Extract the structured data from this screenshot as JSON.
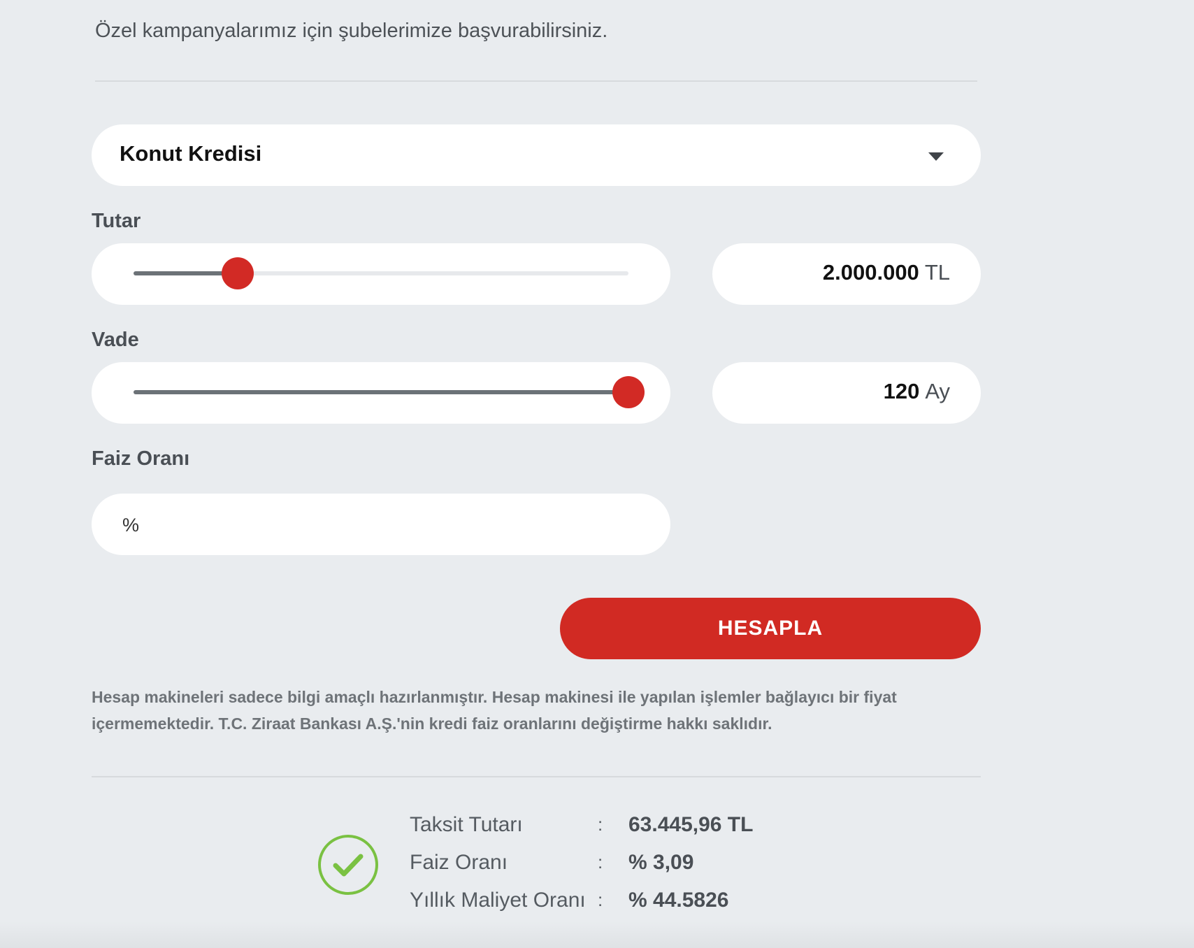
{
  "intro_text": "Özel kampanyalarımız için şubelerimize başvurabilirsiniz.",
  "loan_type": {
    "selected": "Konut Kredisi",
    "caret_icon": "chevron-down-icon"
  },
  "amount": {
    "label": "Tutar",
    "value": "2.000.000",
    "unit": "TL",
    "slider_fraction": 0.21
  },
  "term": {
    "label": "Vade",
    "value": "120",
    "unit": "Ay",
    "slider_fraction": 1.0
  },
  "interest": {
    "label": "Faiz Oranı",
    "prefix": "%"
  },
  "calculate_button": "HESAPLA",
  "disclaimer": "Hesap makineleri sadece bilgi amaçlı hazırlanmıştır. Hesap makinesi ile yapılan işlemler bağlayıcı bir fiyat içermemektedir. T.C. Ziraat Bankası A.Ş.'nin kredi faiz oranlarını değiştirme hakkı saklıdır.",
  "result": {
    "icon": "check-circle-icon",
    "rows": [
      {
        "label": "Taksit Tutarı",
        "separator": ":",
        "value": "63.445,96 TL"
      },
      {
        "label": "Faiz Oranı",
        "separator": ":",
        "value": "% 3,09"
      },
      {
        "label": "Yıllık Maliyet Oranı",
        "separator": ":",
        "value": "% 44.5826"
      }
    ]
  },
  "colors": {
    "accent": "#d12a23",
    "success": "#7ac142",
    "background": "#e9ecef"
  }
}
